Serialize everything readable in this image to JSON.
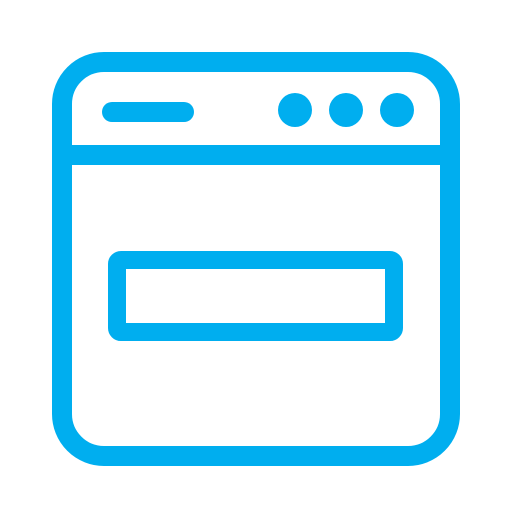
{
  "icon": {
    "name": "browser-window-icon",
    "color": "#00AEEF",
    "background": "#FFFFFF"
  }
}
